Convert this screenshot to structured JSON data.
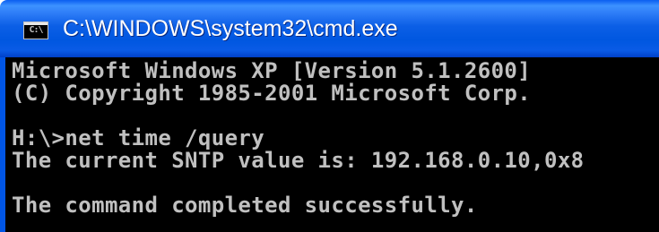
{
  "window": {
    "title": "C:\\WINDOWS\\system32\\cmd.exe",
    "icon": "command-prompt-icon",
    "icon_text": "C:\\"
  },
  "console": {
    "lines": [
      "Microsoft Windows XP [Version 5.1.2600]",
      "(C) Copyright 1985-2001 Microsoft Corp.",
      "H:\\>net time /query",
      "The current SNTP value is: 192.168.0.10,0x8",
      "The command completed successfully."
    ],
    "text_color": "#c0c0c0",
    "background_color": "#000000"
  },
  "colors": {
    "titlebar": "#0057e0",
    "frame": "#0055e5"
  }
}
